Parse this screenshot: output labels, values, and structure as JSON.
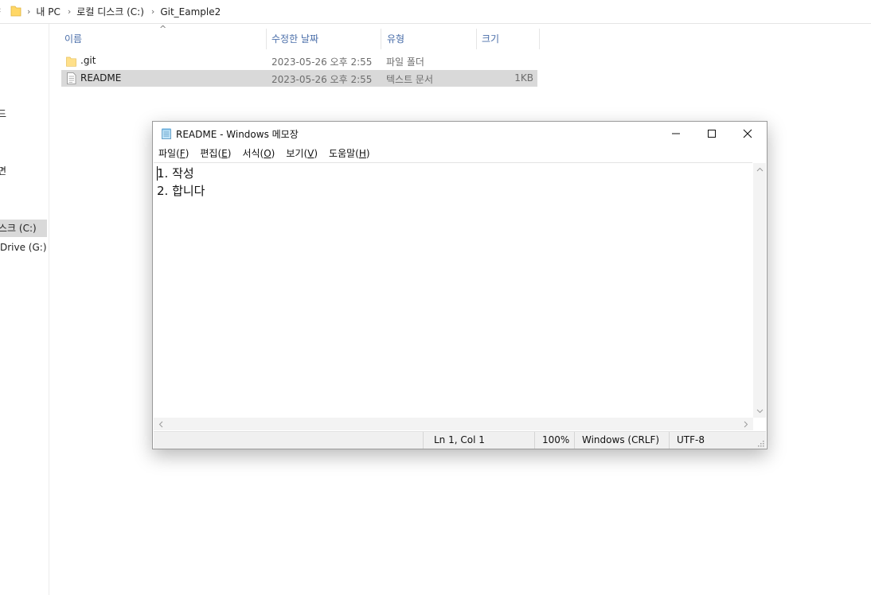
{
  "explorer": {
    "breadcrumbs": [
      "내 PC",
      "로컬 디스크 (C:)",
      "Git_Eample2"
    ],
    "nav_items": [
      "드",
      "면",
      "스크 (C:)",
      "Drive (G:)"
    ],
    "columns": {
      "name": "이름",
      "modified": "수정한 날짜",
      "type": "유형",
      "size": "크기"
    },
    "sort_indicator": "^",
    "files": [
      {
        "name": ".git",
        "modified": "2023-05-26 오후 2:55",
        "type": "파일 폴더",
        "size": "",
        "icon": "folder-icon"
      },
      {
        "name": "README",
        "modified": "2023-05-26 오후 2:55",
        "type": "텍스트 문서",
        "size": "1KB",
        "icon": "text-file-icon"
      }
    ]
  },
  "notepad": {
    "title": "README - Windows 메모장",
    "menu": [
      {
        "label": "파일",
        "key": "F"
      },
      {
        "label": "편집",
        "key": "E"
      },
      {
        "label": "서식",
        "key": "O"
      },
      {
        "label": "보기",
        "key": "V"
      },
      {
        "label": "도움말",
        "key": "H"
      }
    ],
    "content_lines": [
      "1. 작성",
      "2. 합니다"
    ],
    "status": {
      "position": "Ln 1, Col 1",
      "zoom": "100%",
      "line_ending": "Windows (CRLF)",
      "encoding": "UTF-8"
    }
  },
  "colors": {
    "selection": "#d9d9d9",
    "column_header_text": "#4a6ea9",
    "folder_yellow": "#ffd766"
  }
}
